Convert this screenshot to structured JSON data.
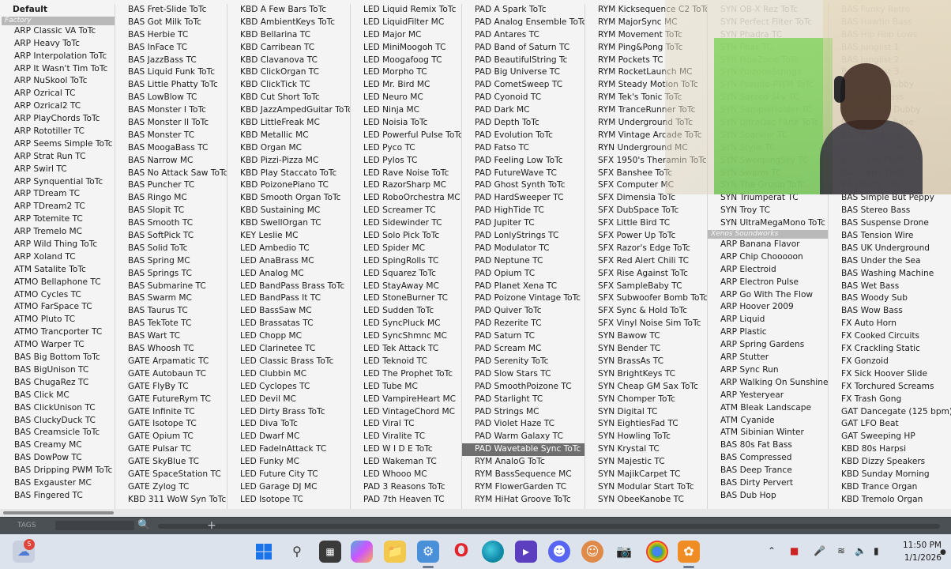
{
  "columns": [
    {
      "items": [
        {
          "label": "Default",
          "kind": "first"
        },
        {
          "label": "Factory",
          "kind": "header"
        },
        "ARP Classic VA ToTc",
        "ARP Heavy ToTc",
        "ARP Interpolation ToTc",
        "ARP It Wasn't Tim ToTc",
        "ARP NuSkool ToTc",
        "ARP Ozrical TC",
        "ARP Ozrical2 TC",
        "ARP PlayChords ToTc",
        "ARP Rototiller TC",
        "ARP Seems Simple ToTc",
        "ARP Strat Run TC",
        "ARP Swirl TC",
        "ARP Synquential ToTc",
        "ARP TDream TC",
        "ARP TDream2 TC",
        "ARP Totemite TC",
        "ARP Tremelo MC",
        "ARP Wild Thing ToTc",
        "ARP Xoland TC",
        "ATM Satalite ToTc",
        "ATMO Bellaphone TC",
        "ATMO Cycles TC",
        "ATMO FarSpace TC",
        "ATMO Pluto TC",
        "ATMO Trancporter TC",
        "ATMO Warper TC",
        "BAS Big Bottom ToTc",
        "BAS BigUnison TC",
        "BAS ChugaRez TC",
        "BAS Click MC",
        "BAS ClickUnison TC",
        "BAS CluckyDuck TC",
        "BAS Creamsicle ToTc",
        "BAS Creamy MC",
        "BAS DowPow TC",
        "BAS Dripping PWM ToTc",
        "BAS Exgauster MC",
        "BAS Fingered TC"
      ]
    },
    {
      "items": [
        "BAS Fret-Slide ToTc",
        "BAS Got Milk ToTc",
        "BAS Herbie TC",
        "BAS InFace TC",
        "BAS JazzBass TC",
        "BAS Liquid Funk ToTc",
        "BAS Little Phatty ToTc",
        "BAS LowBlow TC",
        "BAS Monster I ToTc",
        "BAS Monster II ToTc",
        "BAS Monster TC",
        "BAS MoogaBass TC",
        "BAS Narrow MC",
        "BAS No Attack Saw ToTc",
        "BAS Puncher TC",
        "BAS Ringo MC",
        "BAS Slopit TC",
        "BAS Smooth TC",
        "BAS SoftPick TC",
        "BAS Solid ToTc",
        "BAS Spring MC",
        "BAS Springs TC",
        "BAS Submarine TC",
        "BAS Swarm MC",
        "BAS Taurus TC",
        "BAS TekTote TC",
        "BAS Wart TC",
        "BAS Whoosh TC",
        "GATE Arpamatic TC",
        "GATE Autobaun TC",
        "GATE FlyBy TC",
        "GATE FutureRym TC",
        "GATE Infinite TC",
        "GATE Isotope TC",
        "GATE Opium TC",
        "GATE Pulsar TC",
        "GATE SkyBlue TC",
        "GATE SpaceStation TC",
        "GATE Zylog TC",
        "KBD 311 WoW Syn ToTc"
      ]
    },
    {
      "items": [
        "KBD A Few Bars ToTc",
        "KBD AmbientKeys ToTc",
        "KBD Bellarina TC",
        "KBD Carribean TC",
        "KBD Clavanova TC",
        "KBD ClickOrgan TC",
        "KBD ClickTick TC",
        "KBD Cut Short ToTc",
        "KBD JazzAmpedGuitar ToTc",
        "KBD LittleFreak MC",
        "KBD Metallic MC",
        "KBD Organ MC",
        "KBD Pizzi-Pizza MC",
        "KBD Play Staccato ToTc",
        "KBD PoizonePiano TC",
        "KBD Smooth Organ ToTc",
        "KBD Sustaining MC",
        "KBD SwellOrgan TC",
        "KEY Leslie MC",
        "LED Ambedio TC",
        "LED AnaBrass MC",
        "LED Analog MC",
        "LED BandPass Brass ToTc",
        "LED BandPass It TC",
        "LED BassSaw MC",
        "LED Brassatas TC",
        "LED Chopp MC",
        "LED Clarinetee TC",
        "LED Classic Brass ToTc",
        "LED Clubbin MC",
        "LED Cyclopes TC",
        "LED Devil MC",
        "LED Dirty Brass ToTc",
        "LED Diva ToTc",
        "LED Dwarf MC",
        "LED FadeInAttack TC",
        "LED Funky MC",
        "LED Future City TC",
        "LED Garage DJ MC",
        "LED Isotope TC"
      ]
    },
    {
      "items": [
        "LED Liquid Remix ToTc",
        "LED LiquidFilter MC",
        "LED Major MC",
        "LED MiniMoogoh TC",
        "LED Moogafoog TC",
        "LED Morpho TC",
        "LED Mr. Bird MC",
        "LED Neuro MC",
        "LED Ninja MC",
        "LED Noisia ToTc",
        "LED Powerful Pulse ToTc",
        "LED Pyco TC",
        "LED Pylos TC",
        "LED Rave Noise ToTc",
        "LED RazorSharp MC",
        "LED RoboOrchestra MC",
        "LED Screamer TC",
        "LED Sidewinder TC",
        "LED Solo Pick ToTc",
        "LED Spider MC",
        "LED SpingRolls TC",
        "LED Squarez ToTc",
        "LED StayAway MC",
        "LED StoneBurner TC",
        "LED Sudden ToTc",
        "LED SyncPluck MC",
        "LED SyncShmnc MC",
        "LED Tek Attack TC",
        "LED Teknoid TC",
        "LED The Prophet ToTc",
        "LED Tube MC",
        "LED VampireHeart MC",
        "LED VintageChord MC",
        "LED Viral TC",
        "LED Viralite TC",
        "LED W I D E ToTc",
        "LED Wakeman TC",
        "LED Whooo MC",
        "PAD 3 Reasons ToTc",
        "PAD 7th Heaven TC"
      ]
    },
    {
      "items": [
        "PAD A Spark ToTc",
        "PAD Analog Ensemble ToTc",
        "PAD Antares TC",
        "PAD Band of Saturn TC",
        "PAD BeautifulString Tc",
        "PAD Big Universe TC",
        "PAD CometSweep TC",
        "PAD Cyonoid TC",
        "PAD Dark MC",
        "PAD Depth ToTc",
        "PAD Evolution ToTc",
        "PAD Fatso TC",
        "PAD Feeling Low ToTc",
        "PAD FutureWave TC",
        "PAD Ghost Synth ToTc",
        "PAD HardSweeper TC",
        "PAD HighTide TC",
        "PAD Jupiter TC",
        "PAD LonlyStrings TC",
        "PAD Modulator TC",
        "PAD Neptune TC",
        "PAD Opium TC",
        "PAD Planet Xena TC",
        "PAD Poizone Vintage ToTc",
        "PAD Quiver ToTc",
        "PAD Rezerite TC",
        "PAD Saturn TC",
        "PAD Scream MC",
        "PAD Serenity ToTc",
        "PAD Slow Stars TC",
        "PAD SmoothPoizone TC",
        "PAD Starlight TC",
        "PAD Strings MC",
        "PAD Violet Haze TC",
        "PAD Warm Galaxy TC",
        {
          "label": "PAD Wavetable Sync ToTc",
          "kind": "selected"
        },
        "RYM AnaloG ToTc",
        "RYM BassSequence MC",
        "RYM FlowerGarden TC",
        "RYM HiHat Groove ToTc"
      ]
    },
    {
      "items": [
        "RYM Kicksequence C2 ToTc",
        "RYM MajorSync MC",
        "RYM Movement ToTc",
        "RYM Ping&Pong ToTc",
        "RYM Pockets TC",
        "RYM RocketLaunch MC",
        "RYM Steady Motion ToTc",
        "RYM Tek's Tonic ToTc",
        "RYM TranceRunner ToTc",
        "RYM Underground ToTc",
        "RYM Vintage Arcade ToTc",
        "RYN Underground MC",
        "SFX 1950's Theramin ToTc",
        "SFX Banshee ToTc",
        "SFX Computer MC",
        "SFX Dimensia ToTc",
        "SFX DubSpace ToTc",
        "SFX Little Bird TC",
        "SFX Power Up ToTc",
        "SFX Razor's Edge ToTc",
        "SFX Red Alert Chili TC",
        "SFX Rise Against ToTc",
        "SFX SampleBaby TC",
        "SFX Subwoofer Bomb ToTc",
        "SFX Sync & Hold ToTc",
        "SFX Vinyl Noise Sim ToTc",
        "SYN Bawow TC",
        "SYN Bender TC",
        "SYN BrassAs TC",
        "SYN BrightKeys TC",
        "SYN Cheap GM Sax ToTc",
        "SYN Chomper ToTc",
        "SYN Digital TC",
        "SYN EightiesFad TC",
        "SYN Howling ToTc",
        "SYN Krystal TC",
        "SYN Majestic TC",
        "SYN MajikCarpet TC",
        "SYN Modular Start ToTc",
        "SYN ObeeKanobe TC"
      ]
    },
    {
      "items": [
        {
          "label": "SYN OB-X Rez ToTc",
          "kind": "dim"
        },
        {
          "label": "SYN Perfect Filter ToTc",
          "kind": "dim"
        },
        {
          "label": "SYN Phadra TC",
          "kind": "dim"
        },
        {
          "label": "SYN Phaz TC",
          "kind": "dim"
        },
        {
          "label": "SYN PipeZone ToTc",
          "kind": "dim"
        },
        {
          "label": "SYN PoizoneStrings",
          "kind": "dim"
        },
        {
          "label": "SYN Pseudo-PWM ToTc",
          "kind": "dim"
        },
        {
          "label": "SYN Sacred Sky TC",
          "kind": "dim"
        },
        {
          "label": "SYN SampleHolder TC",
          "kind": "dim"
        },
        {
          "label": "SYN UltraOsc Flute ToTc",
          "kind": "dim"
        },
        {
          "label": "SYN Sparkler TC",
          "kind": "dim"
        },
        {
          "label": "SYN Stylis TC",
          "kind": "dim"
        },
        {
          "label": "SYN SweepingSky TC",
          "kind": "dim"
        },
        {
          "label": "SYN Swarm TC",
          "kind": "dim"
        },
        {
          "label": "SYN The Gruslo ToTc",
          "kind": "dim"
        },
        "SYN Triumperat TC",
        "SYN Troy TC",
        "SYN UltraMegaMono ToTc",
        {
          "label": "Xenos Soundworks",
          "kind": "header"
        },
        "ARP Banana Flavor",
        "ARP Chip Chooooon",
        "ARP Electroid",
        "ARP Electron Pulse",
        "ARP Go With The Flow",
        "ARP Hoover 2009",
        "ARP Liquid",
        "ARP Plastic",
        "ARP Spring Gardens",
        "ARP Stutter",
        "ARP Sync Run",
        "ARP Walking On Sunshine",
        "ARP Yesteryear",
        "ATM Bleak Landscape",
        "ATM Cyanide",
        "ATM Sibinian Winter",
        "BAS 80s Fat Bass",
        "BAS Compressed",
        "BAS Deep Trance",
        "BAS Dirty Pervert",
        "BAS Dub Hop"
      ]
    },
    {
      "items": [
        {
          "label": "BAS Funky Retro",
          "kind": "dim"
        },
        {
          "label": "BAS Hawtin Bass",
          "kind": "dim"
        },
        {
          "label": "BAS Hip Hop Lows",
          "kind": "dim"
        },
        {
          "label": "BAS Junglist 1",
          "kind": "dim"
        },
        {
          "label": "BAS Junglist 2",
          "kind": "dim"
        },
        {
          "label": "BAS Junglist 3",
          "kind": "dim"
        },
        {
          "label": "BAS Jungle Tubby",
          "kind": "dim"
        },
        {
          "label": "BAS Fatty Bass",
          "kind": "dim"
        },
        {
          "label": "BAS Hello N Dubby",
          "kind": "dim"
        },
        {
          "label": "BAS Octave Rave",
          "kind": "dim"
        },
        {
          "label": "BAS Pure bass",
          "kind": "dim"
        },
        {
          "label": "BAS Punchy Analog",
          "kind": "dim"
        },
        {
          "label": "BAS Rave PWM",
          "kind": "dim"
        },
        {
          "label": "BAS Retro DnB",
          "kind": "dim"
        },
        {
          "label": "BAS Retro 303",
          "kind": "dim"
        },
        "BAS Simple But Peppy",
        "BAS Stereo Bass",
        "BAS Suspense Drone",
        "BAS Tension Wire",
        "BAS UK Underground",
        "BAS Under the Sea",
        "BAS Washing Machine",
        "BAS Wet Bass",
        "BAS Woody Sub",
        "BAS Wow Bass",
        "FX Auto Horn",
        "FX Cooked Circuits",
        "FX Crackling Static",
        "FX Gonzoid",
        "FX Sick Hoover Slide",
        "FX Torchured Screams",
        "FX Trash Gong",
        "GAT Dancegate (125 bpm)",
        "GAT LFO Beat",
        "GAT Sweeping HP",
        "KBD 80s Harpsi",
        "KBD Dizzy Speakers",
        "KBD Sunday Morning",
        "KBD Trance Organ",
        "KBD Tremolo Organ"
      ]
    }
  ],
  "fl_strip": {
    "tabs_label": "TAGS"
  },
  "taskbar": {
    "icons": [
      "cloud-notification-icon",
      "windows-start-icon",
      "search-icon",
      "file-explorer-icon",
      "copilot-icon",
      "folder-icon",
      "app-icon",
      "opera-icon",
      "edge-icon",
      "media-icon",
      "discord-icon",
      "game-icon",
      "camera-icon",
      "chrome-icon",
      "fl-studio-icon"
    ],
    "badge_count": "5",
    "time": "11:50 PM",
    "date": "1/1/2026"
  },
  "colors": {
    "selected_bg": "#6f6f6f",
    "header_bg": "#b9b9b9",
    "taskbar_bg": "#dde3ec"
  }
}
